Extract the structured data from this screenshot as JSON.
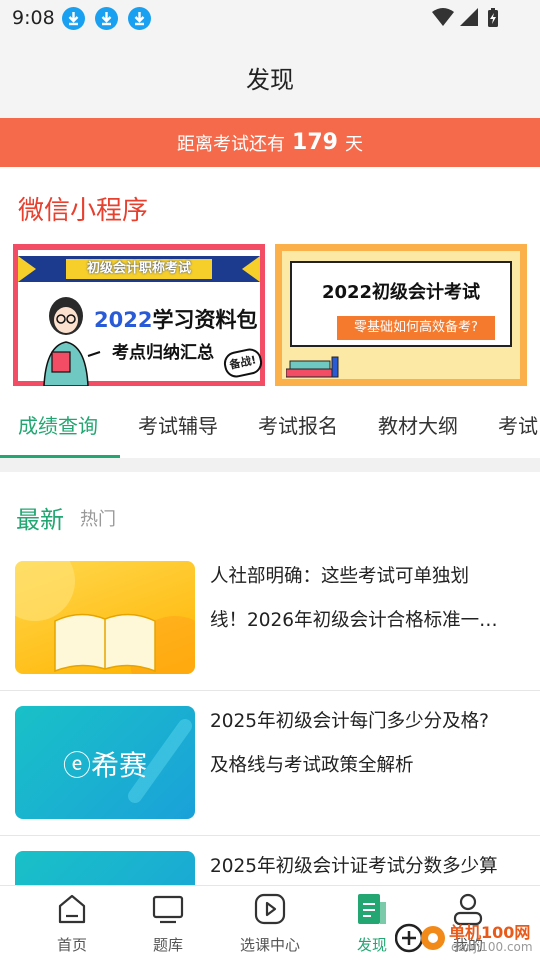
{
  "status_bar": {
    "time": "9:08",
    "icons": [
      "download-icon",
      "download-icon",
      "download-icon",
      "wifi-icon",
      "signal-icon",
      "battery-icon"
    ]
  },
  "header": {
    "title": "发现"
  },
  "countdown": {
    "prefix": "距离考试还有",
    "days": "179",
    "suffix": "天"
  },
  "mini_programs": {
    "title": "微信小程序",
    "banners": [
      {
        "ribbon": "初级会计职称考试",
        "line1_year": "2022",
        "line1_rest": "学习资料包",
        "line2": "考点归纳汇总",
        "stamp": "备战!"
      },
      {
        "line1": "2022初级会计考试",
        "line2": "零基础如何高效备考?"
      }
    ]
  },
  "tabs": {
    "items": [
      {
        "label": "成绩查询",
        "active": true
      },
      {
        "label": "考试辅导"
      },
      {
        "label": "考试报名"
      },
      {
        "label": "教材大纲"
      },
      {
        "label": "考试"
      }
    ]
  },
  "news": {
    "subtabs": {
      "new": "最新",
      "hot": "热门"
    },
    "articles": [
      {
        "title_l1": "人社部明确：这些考试可单独划",
        "title_l2": "线！2026年初级会计合格标准一…",
        "thumb": "book-illustration"
      },
      {
        "title_l1": "2025年初级会计每门多少分及格?",
        "title_l2": "及格线与考试政策全解析",
        "thumb": "xisai-logo",
        "thumb_text": "希赛"
      },
      {
        "title_l1": "2025年初级会计证考试分数多少算",
        "title_l2": "",
        "thumb": "xisai-logo"
      }
    ]
  },
  "bottom_nav": {
    "items": [
      {
        "label": "首页",
        "icon": "home-icon"
      },
      {
        "label": "题库",
        "icon": "monitor-icon"
      },
      {
        "label": "选课中心",
        "icon": "play-icon"
      },
      {
        "label": "发现",
        "icon": "discover-icon",
        "active": true
      },
      {
        "label": "我的",
        "icon": "user-icon"
      }
    ]
  },
  "watermark": {
    "site": "单机100网",
    "url": "danji100.com"
  },
  "colors": {
    "accent_green": "#23a672",
    "countdown_bg": "#f56a4a",
    "title_red": "#e8402f"
  }
}
